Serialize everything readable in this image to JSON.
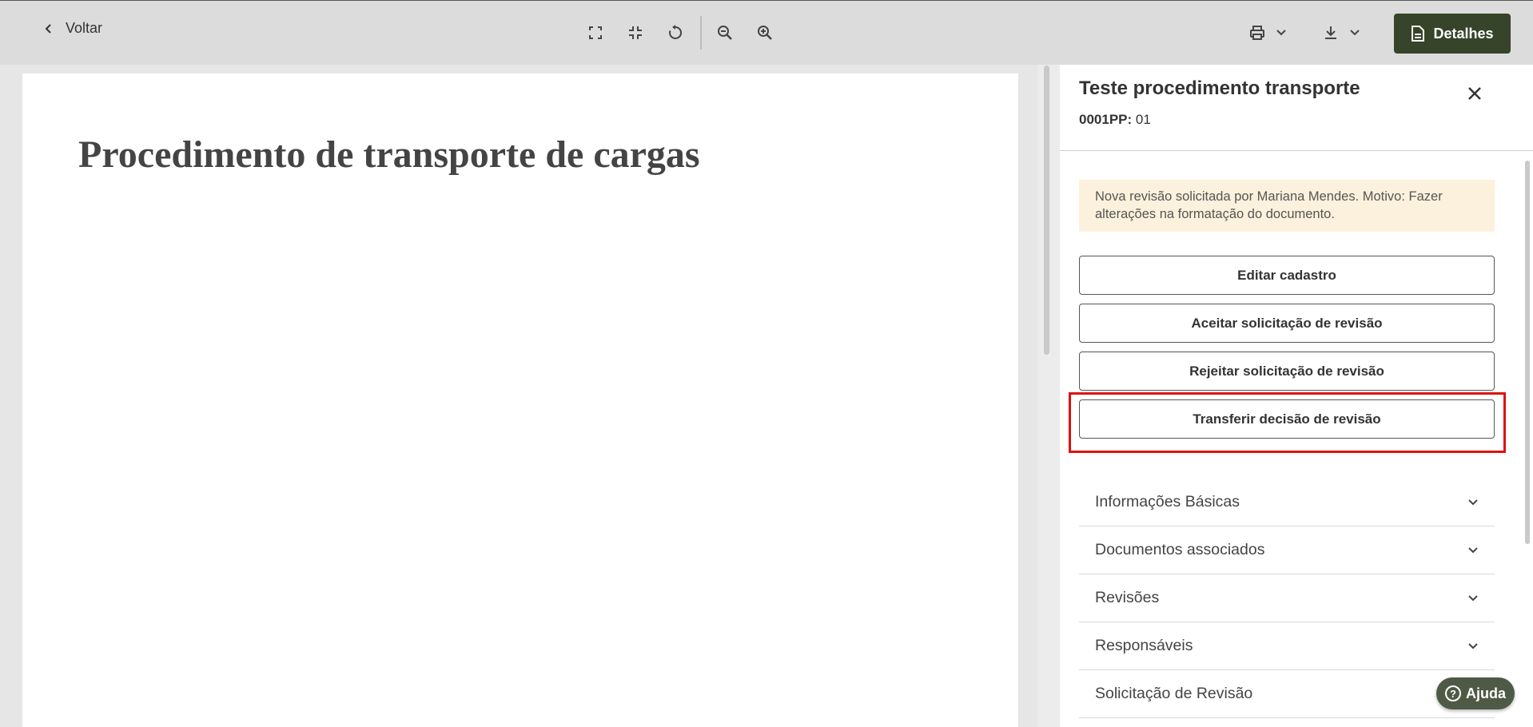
{
  "toolbar": {
    "back_label": "Voltar",
    "icons": [
      "fullscreen-icon",
      "exit-fullscreen-icon",
      "rotate-icon",
      "zoom-out-icon",
      "zoom-in-icon",
      "print-icon",
      "download-icon"
    ],
    "details_label": "Detalhes"
  },
  "document": {
    "title": "Procedimento de transporte de cargas"
  },
  "panel": {
    "title": "Teste procedimento transporte",
    "code_label": "0001PP:",
    "code_value": "01",
    "notice": "Nova revisão solicitada por Mariana Mendes. Motivo: Fazer alterações na formatação do documento.",
    "actions": [
      {
        "label": "Editar cadastro"
      },
      {
        "label": "Aceitar solicitação de revisão"
      },
      {
        "label": "Rejeitar solicitação de revisão"
      },
      {
        "label": "Transferir decisão de revisão",
        "highlighted": true
      }
    ],
    "sections": [
      {
        "label": "Informações Básicas"
      },
      {
        "label": "Documentos associados"
      },
      {
        "label": "Revisões"
      },
      {
        "label": "Responsáveis"
      },
      {
        "label": "Solicitação de Revisão"
      }
    ]
  },
  "help": {
    "label": "Ajuda"
  },
  "colors": {
    "toolbar_bg": "#dcdcdc",
    "primary": "#36442a",
    "notice_bg": "#fcf1dc",
    "highlight": "#e01010",
    "help_bg": "#4e5a45"
  }
}
